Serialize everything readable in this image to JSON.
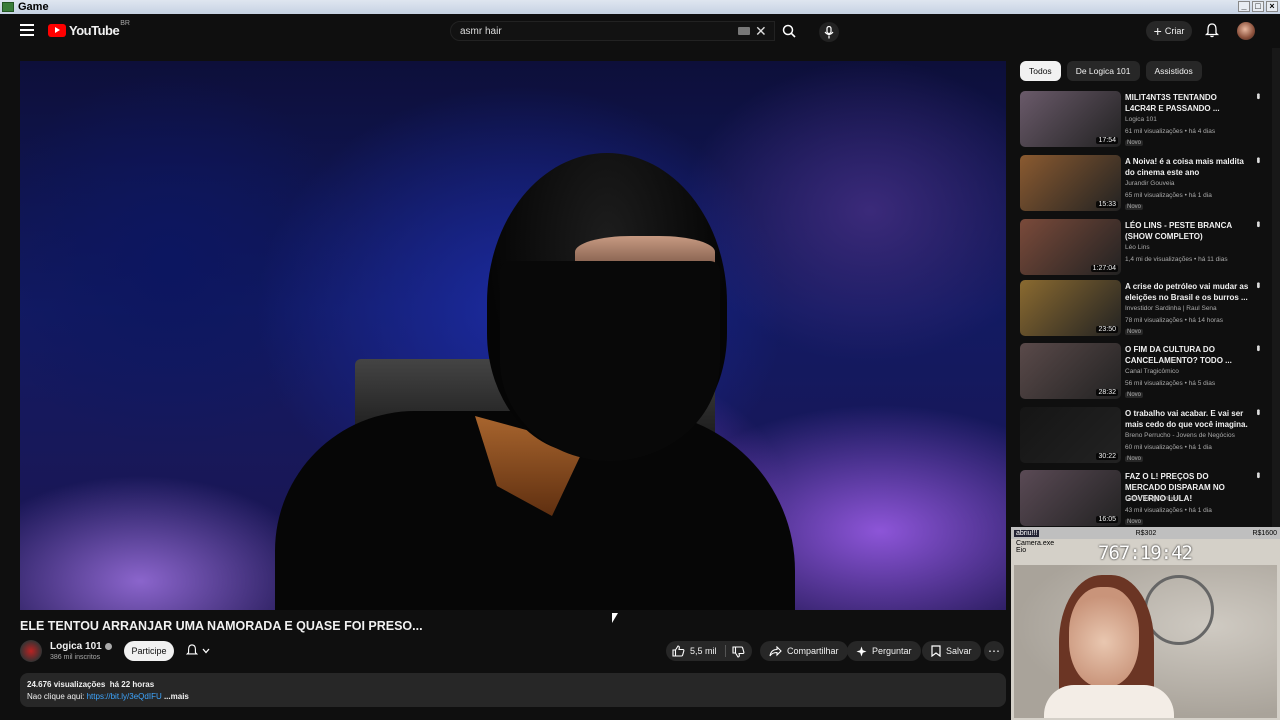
{
  "window": {
    "title": "Game"
  },
  "topbar": {
    "logo_text": "YouTube",
    "country": "BR",
    "search_value": "asmr hair",
    "create_label": "Criar"
  },
  "video": {
    "title": "ELE TENTOU ARRANJAR UMA NAMORADA E QUASE FOI PRESO...",
    "channel": "Logica 101",
    "subscribers": "386 mil inscritos",
    "join_label": "Participe",
    "likes": "5,5 mil",
    "share_label": "Compartilhar",
    "ask_label": "Perguntar",
    "save_label": "Salvar",
    "views": "24.676 visualizações",
    "age": "há 22 horas",
    "desc_prefix": "Nao clique aqui: ",
    "desc_link": "https://bit.ly/3eQdIFU",
    "desc_more": " ...mais"
  },
  "chips": [
    {
      "label": "Todos",
      "active": true
    },
    {
      "label": "De Logica 101"
    },
    {
      "label": "Assistidos"
    }
  ],
  "recommendations": [
    {
      "title": "MILIT4NT3S TENTANDO L4CR4R E PASSANDO ...",
      "channel": "Logica 101",
      "meta": "61 mil visualizações • há 4 dias",
      "badge": "Novo",
      "duration": "17:54",
      "color": "#6a5a6a"
    },
    {
      "title": "A Noiva! é a coisa mais maldita do cinema este ano",
      "channel": "Jurandir Gouveia",
      "meta": "65 mil visualizações • há 1 dia",
      "badge": "Novo",
      "duration": "15:33",
      "color": "#8a5a30"
    },
    {
      "title": "LÉO LINS - PESTE BRANCA (SHOW COMPLETO)",
      "channel": "Léo Lins",
      "meta": "1,4 mi de visualizações • há 11 dias",
      "badge": "",
      "duration": "1:27:04",
      "color": "#7a4a3a"
    },
    {
      "title": "A crise do petróleo vai mudar as eleições no Brasil e os burros ...",
      "channel": "Investidor Sardinha | Raul Sena",
      "meta": "78 mil visualizações • há 14 horas",
      "badge": "Novo",
      "duration": "23:50",
      "color": "#8a6a30"
    },
    {
      "title": "O FIM DA CULTURA DO CANCELAMENTO? TODO ...",
      "channel": "Canal Tragicômico",
      "meta": "56 mil visualizações • há 5 dias",
      "badge": "Novo",
      "duration": "28:32",
      "color": "#5a4a4a"
    },
    {
      "title": "O trabalho vai acabar. E vai ser mais cedo do que você imagina.",
      "channel": "Breno Perrucho - Jovens de Negócios",
      "meta": "60 mil visualizações • há 1 dia",
      "badge": "Novo",
      "duration": "30:22",
      "color": "#151515"
    },
    {
      "title": "FAZ O L! PREÇOS DO MERCADO DISPARAM NO GOVERNO LULA!",
      "channel": "Canal Tragicômico",
      "meta": "43 mil visualizações • há 1 dia",
      "badge": "Novo",
      "duration": "16:05",
      "color": "#5a4a55"
    }
  ],
  "overlay": {
    "header_left": "abriu!!!",
    "header_mid": "R$302",
    "header_right": "R$1600",
    "app_label": "Camera.exe",
    "file_label": "Eio",
    "timer": "767:19:42"
  }
}
